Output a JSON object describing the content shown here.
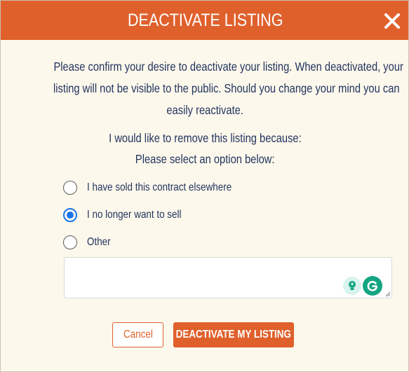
{
  "modal": {
    "title": "DEACTIVATE LISTING",
    "intro_lines": [
      "Please confirm your desire to deactivate your listing. When deactivated, your",
      "listing will not be visible to the public. Should you change your mind you can",
      "easily reactivate."
    ],
    "reason_heading": "I would like to remove this listing because:",
    "reason_subheading": "Please select an option below:",
    "options": [
      {
        "label": "I have sold this contract elsewhere",
        "selected": false
      },
      {
        "label": "I no longer want to sell",
        "selected": true
      },
      {
        "label": "Other",
        "selected": false
      }
    ],
    "other_text": {
      "value": "",
      "placeholder": ""
    },
    "buttons": {
      "cancel": "Cancel",
      "deactivate": "DEACTIVATE MY LISTING"
    }
  },
  "colors": {
    "accent": "#e0602c",
    "text": "#21345e",
    "background": "#fdf8ec",
    "radio_selected": "#1a73e8"
  },
  "icons": [
    "close-icon",
    "lightbulb-icon",
    "grammarly-icon",
    "resize-handle-icon"
  ]
}
